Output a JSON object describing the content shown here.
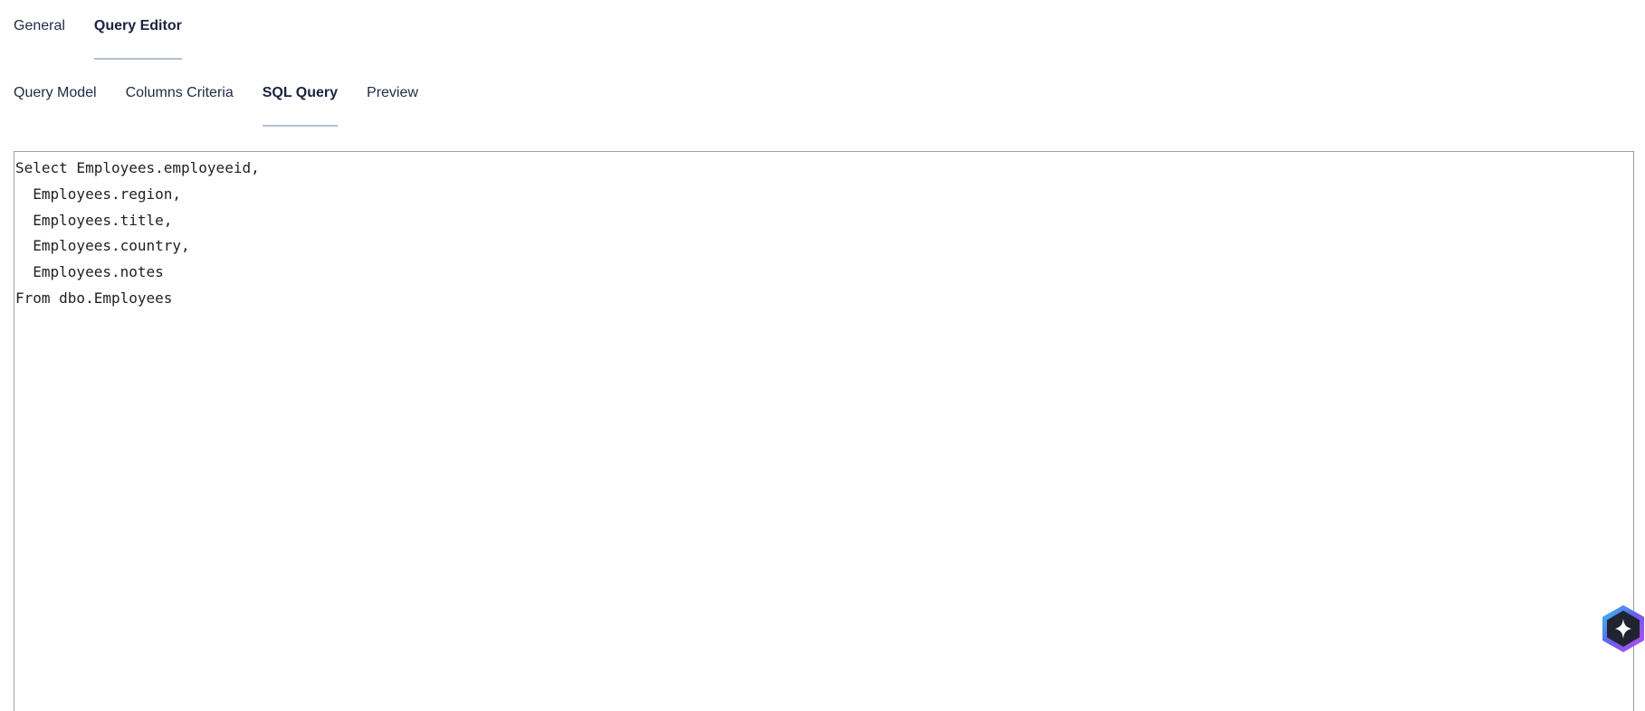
{
  "tabs": {
    "primary": [
      {
        "label": "General",
        "active": false
      },
      {
        "label": "Query Editor",
        "active": true
      }
    ],
    "secondary": [
      {
        "label": "Query Model",
        "active": false
      },
      {
        "label": "Columns Criteria",
        "active": false
      },
      {
        "label": "SQL Query",
        "active": true
      },
      {
        "label": "Preview",
        "active": false
      }
    ]
  },
  "editor": {
    "lines": [
      "Select Employees.employeeid,",
      "  Employees.region,",
      "  Employees.title,",
      "  Employees.country,",
      "  Employees.notes",
      "From dbo.Employees"
    ]
  },
  "assistant": {
    "icon": "sparkle-icon",
    "colors": {
      "start": "#2ec8f0",
      "mid": "#6a5cf0",
      "end": "#c04ef0",
      "inner": "#1f2430"
    }
  }
}
